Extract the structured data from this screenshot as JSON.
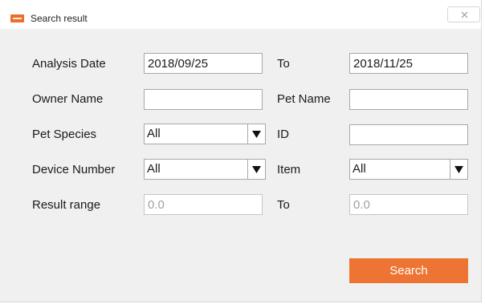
{
  "window": {
    "title": "Search result"
  },
  "form": {
    "analysis_date": {
      "label": "Analysis Date",
      "value": "2018/09/25"
    },
    "analysis_date_to": {
      "label": "To",
      "value": "2018/11/25"
    },
    "owner_name": {
      "label": "Owner Name",
      "value": ""
    },
    "pet_name": {
      "label": "Pet Name",
      "value": ""
    },
    "pet_species": {
      "label": "Pet Species",
      "selected": "All"
    },
    "id": {
      "label": "ID",
      "value": ""
    },
    "device_number": {
      "label": "Device Number",
      "selected": "All"
    },
    "item": {
      "label": "Item",
      "selected": "All"
    },
    "result_range": {
      "label": "Result range",
      "placeholder": "0.0"
    },
    "result_range_to": {
      "label": "To",
      "placeholder": "0.0"
    }
  },
  "actions": {
    "search_label": "Search"
  },
  "colors": {
    "accent": "#ed7432",
    "window_bg": "#f0f0f0"
  },
  "icons": {
    "app": "app-logo-icon",
    "close": "close-icon",
    "dropdown": "dropdown-arrow-icon"
  }
}
